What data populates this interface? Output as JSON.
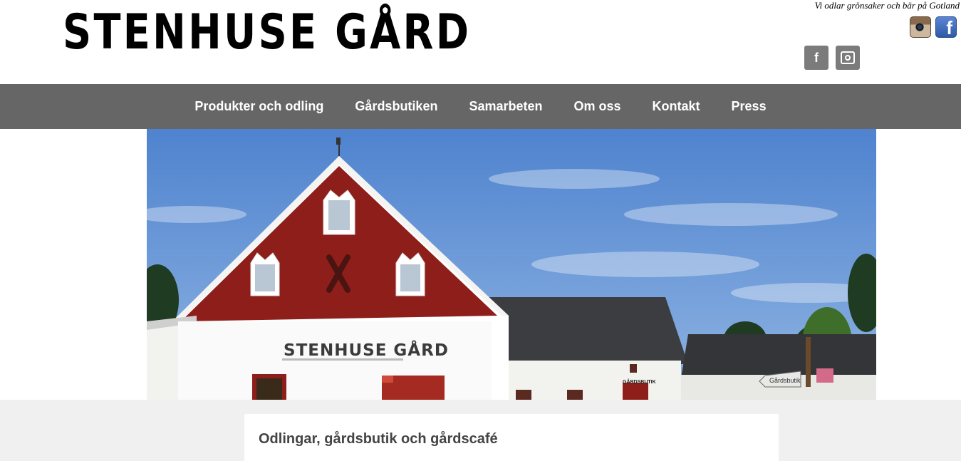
{
  "header": {
    "logo": "STENHUSE GÅRD",
    "tagline": "Vi odlar grönsaker och bär på Gotland",
    "top_icons": [
      "instagram-icon",
      "facebook-icon"
    ],
    "grey_icons": [
      "facebook-icon",
      "instagram-icon"
    ],
    "facebook_glyph": "f"
  },
  "nav": {
    "items": [
      {
        "label": "Produkter och odling"
      },
      {
        "label": "Gårdsbutiken"
      },
      {
        "label": "Samarbeten"
      },
      {
        "label": "Om oss"
      },
      {
        "label": "Kontakt"
      },
      {
        "label": "Press"
      }
    ]
  },
  "hero": {
    "barn_sign": "STENHUSE GÅRD",
    "shop_sign": "GÅRDSBUTIK",
    "road_sign": "Gårdsbutik"
  },
  "content": {
    "card_title": "Odlingar, gårdsbutik och gårdscafé"
  },
  "colors": {
    "nav_bg": "#666666",
    "lower_bg": "#f0f0f0",
    "barn_red": "#8e1e1a",
    "sky": "#5f8fd3"
  }
}
